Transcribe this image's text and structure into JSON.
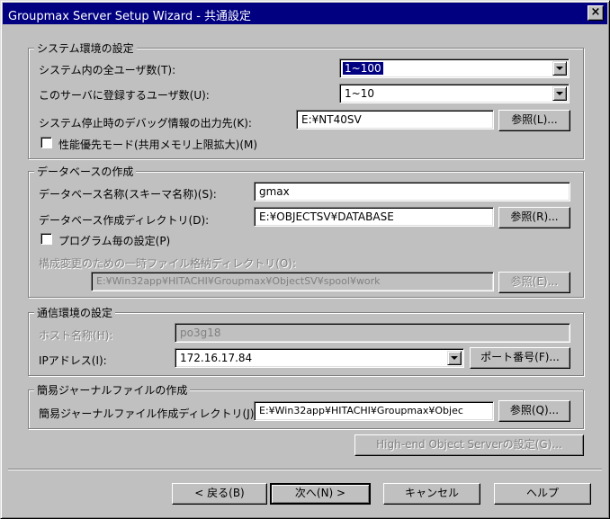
{
  "window": {
    "title": "Groupmax Server Setup Wizard - 共通設定",
    "close_glyph": "×"
  },
  "system_env": {
    "label": "システム環境の設定",
    "total_users_label": "システム内の全ユーザ数(T):",
    "total_users_value": "1~100",
    "server_users_label": "このサーバに登録するユーザ数(U):",
    "server_users_value": "1~10",
    "debug_output_label": "システム停止時のデバッグ情報の出力先(K):",
    "debug_output_value": "E:¥NT40SV",
    "browse_label": "参照(L)...",
    "perf_label": "性能優先モード(共用メモリ上限拡大)(M)"
  },
  "database": {
    "label": "データベースの作成",
    "db_name_label": "データベース名称(スキーマ名称)(S):",
    "db_name_value": "gmax",
    "db_dir_label": "データベース作成ディレクトリ(D):",
    "db_dir_value": "E:¥OBJECTSV¥DATABASE",
    "browse_label": "参照(R)...",
    "per_program_label": "プログラム毎の設定(P)",
    "temp_dir_label": "構成変更のための一時ファイル格納ディレクトリ(O):",
    "temp_dir_value": "E:¥Win32app¥HITACHI¥Groupmax¥ObjectSV¥spool¥work",
    "temp_browse_label": "参照(E)..."
  },
  "network": {
    "label": "通信環境の設定",
    "host_label": "ホスト名称(H):",
    "host_value": "po3g18",
    "ip_label": "IPアドレス(I):",
    "ip_value": "172.16.17.84",
    "port_button_label": "ポート番号(F)..."
  },
  "journal": {
    "label": "簡易ジャーナルファイルの作成",
    "dir_label": "簡易ジャーナルファイル作成ディレクトリ(J):",
    "dir_value": "E:¥Win32app¥HITACHI¥Groupmax¥Objec",
    "browse_label": "参照(Q)..."
  },
  "highend_button_label": "High-end Object Serverの設定(G)...",
  "footer": {
    "back_label": "< 戻る(B)",
    "next_label": "次へ(N) >",
    "cancel_label": "キャンセル",
    "help_label": "ヘルプ"
  },
  "colors": {
    "title_bar": "#000080",
    "face": "#c0c0c0",
    "highlight": "#000080"
  }
}
